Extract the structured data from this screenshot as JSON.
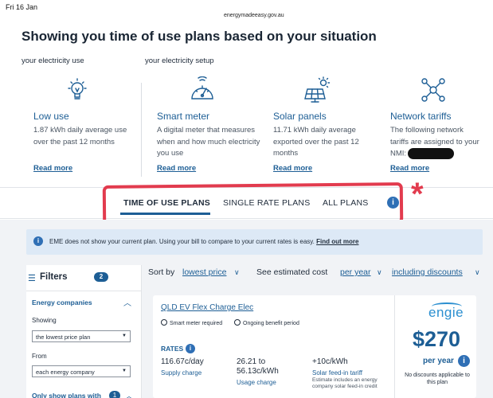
{
  "status": {
    "time": "Fri 16 Jan",
    "url": "energymadeeasy.gov.au"
  },
  "header": {
    "title": "Showing you time of use plans based on your situation",
    "sub_use": "your electricity use",
    "sub_setup": "your electricity setup"
  },
  "cards": [
    {
      "icon": "lightbulb-icon",
      "title": "Low use",
      "desc": "1.87 kWh daily average use over the past 12 months",
      "link": "Read more"
    },
    {
      "icon": "speedometer-icon",
      "title": "Smart meter",
      "desc": "A digital meter that measures when and how much electricity you use",
      "link": "Read more"
    },
    {
      "icon": "solar-panel-icon",
      "title": "Solar panels",
      "desc": "11.71 kWh daily average exported over the past 12 months",
      "link": "Read more"
    },
    {
      "icon": "network-icon",
      "title": "Network tariffs",
      "desc": "The following network tariffs are assigned to your NMI:",
      "link": "Read more"
    }
  ],
  "tabs": [
    {
      "label": "TIME OF USE PLANS",
      "active": true
    },
    {
      "label": "SINGLE RATE PLANS",
      "active": false
    },
    {
      "label": "ALL PLANS",
      "active": false
    }
  ],
  "tabs_info": "i",
  "annotation": {
    "star": "*",
    "color": "#e23b4e"
  },
  "notice": {
    "icon": "i",
    "text": "EME does not show your current plan. Using your bill to compare to your current rates is easy.",
    "link": "Find out more"
  },
  "filters": {
    "label": "Filters",
    "count": "2",
    "energy_companies": "Energy companies",
    "showing_label": "Showing",
    "showing_value": "the lowest price plan",
    "from_label": "From",
    "from_value": "each energy company",
    "only_show": "Only show plans with",
    "only_show_count": "1"
  },
  "sort": {
    "sort_by": "Sort by",
    "sort_value": "lowest price",
    "see_cost": "See estimated cost",
    "cost_value": "per year",
    "discounts": "including discounts"
  },
  "plan": {
    "name": "QLD EV Flex Charge Elec",
    "tag1": "Smart meter required",
    "tag2": "Ongoing benefit period",
    "rates_label": "RATES",
    "supply_value": "116.67c/day",
    "supply_label": "Supply charge",
    "usage_value_1": "26.21 to",
    "usage_value_2": "56.13c/kWh",
    "usage_label": "Usage charge",
    "feedin_value": "+10c/kWh",
    "feedin_label": "Solar feed-in tariff",
    "feedin_note": "Estimate includes an energy company solar feed-in credit",
    "brand": "engie",
    "price": "$270",
    "per_year": "per year",
    "no_discounts": "No discounts applicable to this plan"
  },
  "colors": {
    "accent": "#1d5e95",
    "annotation": "#e23b4e",
    "notice_bg": "#dde9f6"
  }
}
